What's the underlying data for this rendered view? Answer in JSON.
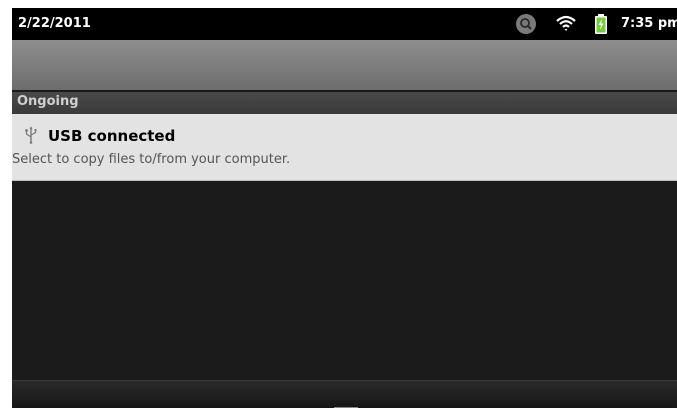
{
  "status_bar": {
    "date": "2/22/2011",
    "time": "7:35 pm",
    "icons": [
      "search-icon",
      "wifi-icon",
      "battery-charging-icon"
    ]
  },
  "notifications": {
    "section_title": "Ongoing",
    "items": [
      {
        "icon": "usb-icon",
        "title": "USB connected",
        "text": "Select to copy files to/from your computer."
      }
    ]
  },
  "colors": {
    "status_bar_bg": "#000000",
    "header_shade": "#7e7e7e",
    "panel_bg": "#1b1b1b",
    "notification_bg": "#e3e3e3",
    "battery_green": "#7ac943"
  }
}
